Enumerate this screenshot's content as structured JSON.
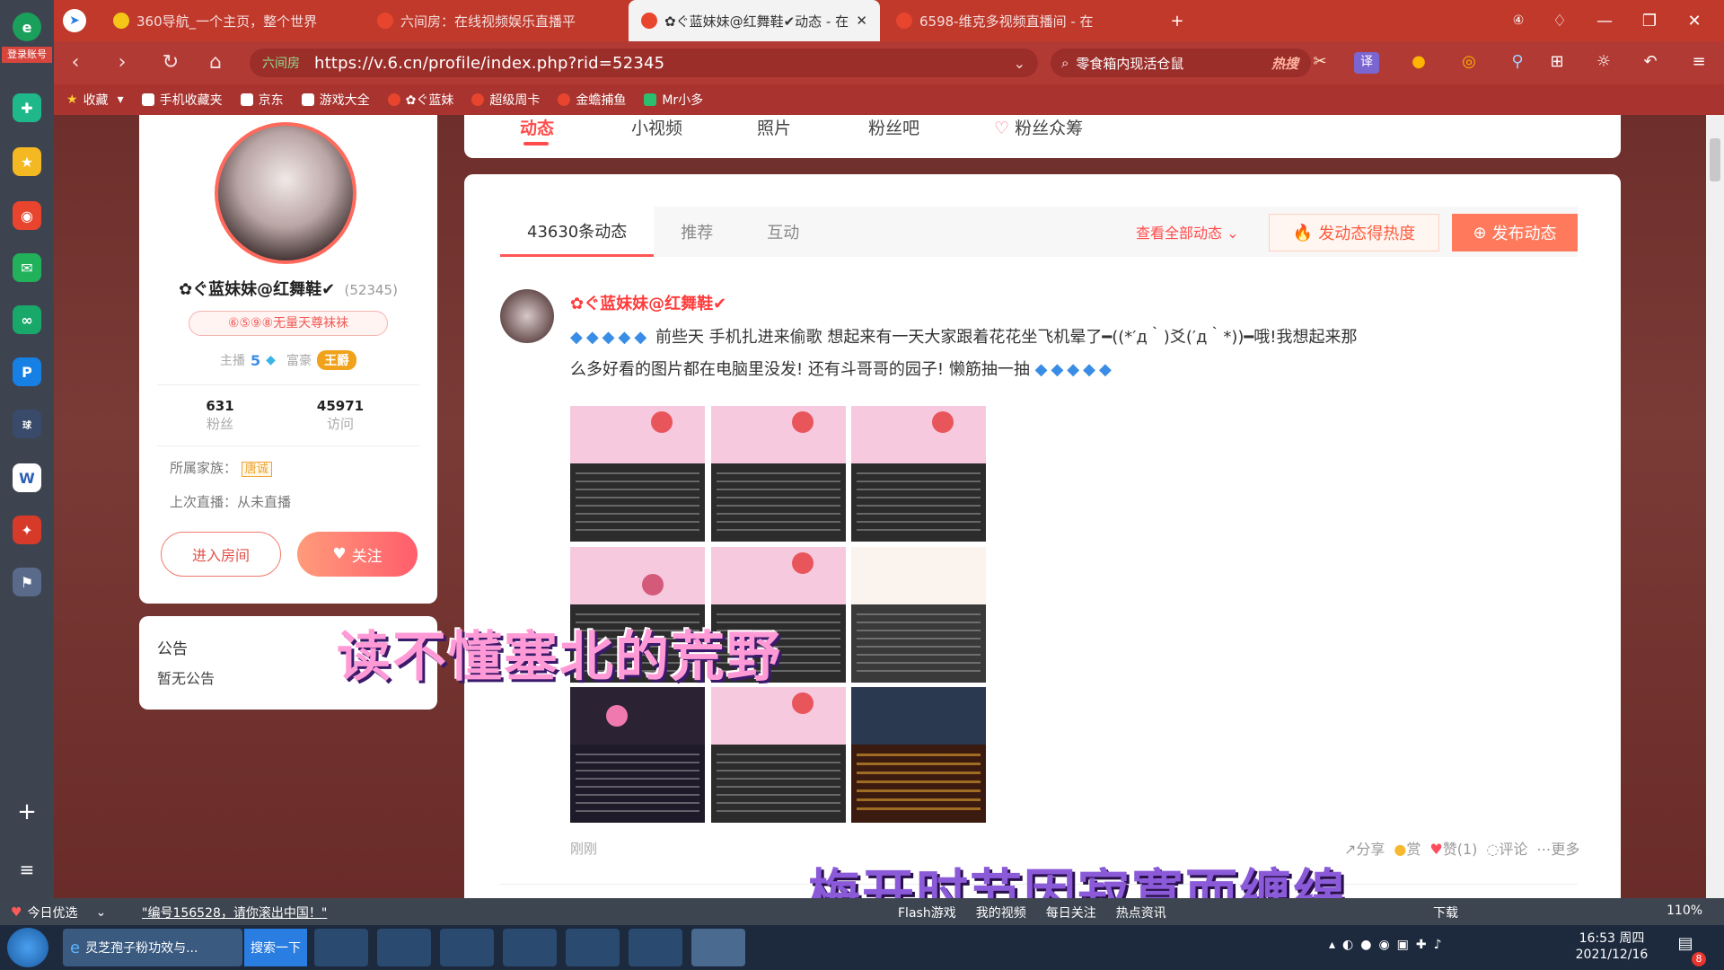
{
  "browser": {
    "tabs": [
      {
        "label": "360导航_一个主页，整个世界"
      },
      {
        "label": "六间房：在线视频娱乐直播平"
      },
      {
        "label": "✿ぐ蓝妹妹@红舞鞋✔动态 - 在"
      },
      {
        "label": "6598-维克多视频直播间 - 在"
      }
    ],
    "url": "https://v.6.cn/profile/index.php?rid=52345",
    "secure_label": "六间房",
    "search_placeholder": "零食箱内现活仓鼠",
    "search_hot": "热搜",
    "login_label": "登录账号",
    "bookmarks": [
      "收藏",
      "手机收藏夹",
      "京东",
      "游戏大全",
      "✿ぐ蓝妹",
      "超级周卡",
      "金蟾捕鱼",
      "Mr小多"
    ]
  },
  "profile": {
    "name": "✿ぐ蓝妹妹@红舞鞋✔",
    "rid": "(52345)",
    "title_badge": "⑥⑤⑨⑧无量天尊袜袜",
    "anchor_label": "主播",
    "anchor_level": "5",
    "rich_label": "富豪",
    "rich_badge": "王爵",
    "fans_count": "631",
    "fans_label": "粉丝",
    "visits_count": "45971",
    "visits_label": "访问",
    "family_label": "所属家族：",
    "family_value": "唐诚",
    "last_live": "上次直播：从未直播",
    "enter_room": "进入房间",
    "follow": "关注",
    "notice_title": "公告",
    "notice_body": "暂无公告"
  },
  "main_nav": [
    "动态",
    "小视频",
    "照片",
    "粉丝吧",
    "粉丝众筹"
  ],
  "feed": {
    "tabs": [
      "43630条动态",
      "推荐",
      "互动"
    ],
    "view_all": "查看全部动态",
    "hot_button": "发动态得热度",
    "post_button": "发布动态",
    "post": {
      "author": "✿ぐ蓝妹妹@红舞鞋✔",
      "text_line1": "前些天 手机扎进来偷歌 想起来有一天大家跟着花花坐飞机晕了━((*′д｀)爻(′д｀*))━哦!我想起来那",
      "text_line2": "么多好看的图片都在电脑里没发! 还有斗哥哥的园子! 懒筋抽一抽",
      "time": "刚刚",
      "actions": [
        "分享",
        "赏",
        "赞(1)",
        "评论",
        "更多"
      ]
    }
  },
  "overlays": {
    "line1": "读不懂塞北的荒野",
    "line2": "梅开时节因寂寞而缠绵"
  },
  "statusbar": {
    "today": "今日优选",
    "news": "\"编号156528，请你滚出中国！\"",
    "items": [
      "Flash游戏",
      "我的视频",
      "每日关注",
      "热点资讯",
      "下载"
    ],
    "zoom": "110%"
  },
  "taskbar": {
    "window1": "灵芝孢子粉功效与...",
    "window1_action": "搜索一下",
    "time": "16:53 周四",
    "date": "2021/12/16",
    "notif_count": "8"
  }
}
